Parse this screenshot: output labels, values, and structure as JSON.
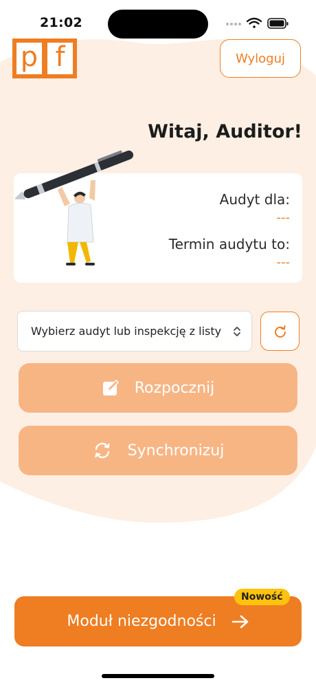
{
  "status_bar": {
    "time": "21:02"
  },
  "logo": {
    "left_letter": "p",
    "right_letter": "f"
  },
  "header": {
    "logout_label": "Wyloguj"
  },
  "greeting": "Witaj, Auditor!",
  "audit_card": {
    "audit_for_label": "Audyt dla:",
    "audit_for_value": "---",
    "deadline_label": "Termin audytu to:",
    "deadline_value": "---"
  },
  "selector": {
    "selected_value": "Wybierz audyt lub inspekcję z listy"
  },
  "actions": {
    "start_label": "Rozpocznij",
    "sync_label": "Synchronizuj"
  },
  "module": {
    "label": "Moduł niezgodności",
    "badge": "Nowość"
  },
  "colors": {
    "accent": "#ef7d21",
    "accent_light": "#f7b584",
    "badge": "#ffc20e",
    "background_tint": "#fdefe4"
  },
  "icons": [
    "edit-icon",
    "sync-icon",
    "refresh-icon",
    "arrow-right-icon",
    "chevron-updown-icon",
    "wifi-icon",
    "battery-icon",
    "signal-icon"
  ]
}
